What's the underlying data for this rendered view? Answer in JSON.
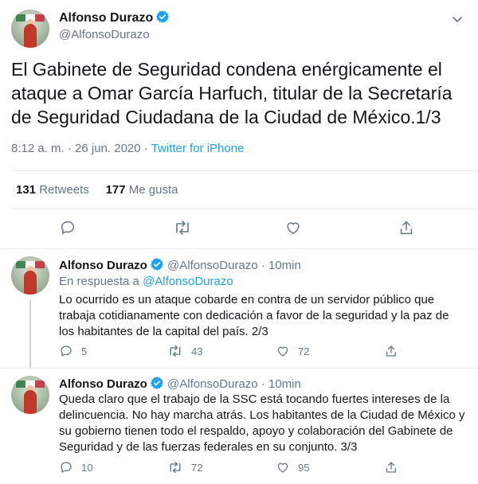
{
  "main_tweet": {
    "name": "Alfonso Durazo",
    "handle": "@AlfonsoDurazo",
    "text": "El Gabinete de Seguridad condena enérgicamente el ataque a Omar García Harfuch, titular de la Secretaría de Seguridad Ciudadana de la Ciudad de México.1/3",
    "time": "8:12 a. m.",
    "date": "26 jun. 2020",
    "separator": "·",
    "source": "Twitter for iPhone",
    "retweets_count": "131",
    "retweets_label": "Retweets",
    "likes_count": "177",
    "likes_label": "Me gusta"
  },
  "replies": [
    {
      "name": "Alfonso Durazo",
      "handle": "@AlfonsoDurazo",
      "separator": "·",
      "time": "10min",
      "in_reply_prefix": "En respuesta a",
      "in_reply_handle": "@AlfonsoDurazo",
      "text": "Lo ocurrido es un ataque cobarde en contra de un servidor público que trabaja cotidianamente con dedicación a favor de  la seguridad y la paz de los habitantes de la capital del país. 2/3",
      "replies": "5",
      "retweets": "43",
      "likes": "72"
    },
    {
      "name": "Alfonso Durazo",
      "handle": "@AlfonsoDurazo",
      "separator": "·",
      "time": "10min",
      "text": "Queda claro que el trabajo de la SSC está tocando fuertes intereses de la delincuencia. No hay marcha atrás. Los habitantes de la Ciudad de México y su gobierno tienen todo el respaldo, apoyo y colaboración del Gabinete de Seguridad y de las fuerzas federales en su conjunto. 3/3",
      "replies": "10",
      "retweets": "72",
      "likes": "95"
    }
  ],
  "icons": {
    "verified": "verified-badge-icon",
    "more": "chevron-down-icon",
    "reply": "reply-icon",
    "retweet": "retweet-icon",
    "like": "heart-icon",
    "share": "share-icon"
  },
  "colors": {
    "accent": "#1da1f2",
    "text": "#14171a",
    "muted": "#657786",
    "divider": "#e6ecf0"
  }
}
